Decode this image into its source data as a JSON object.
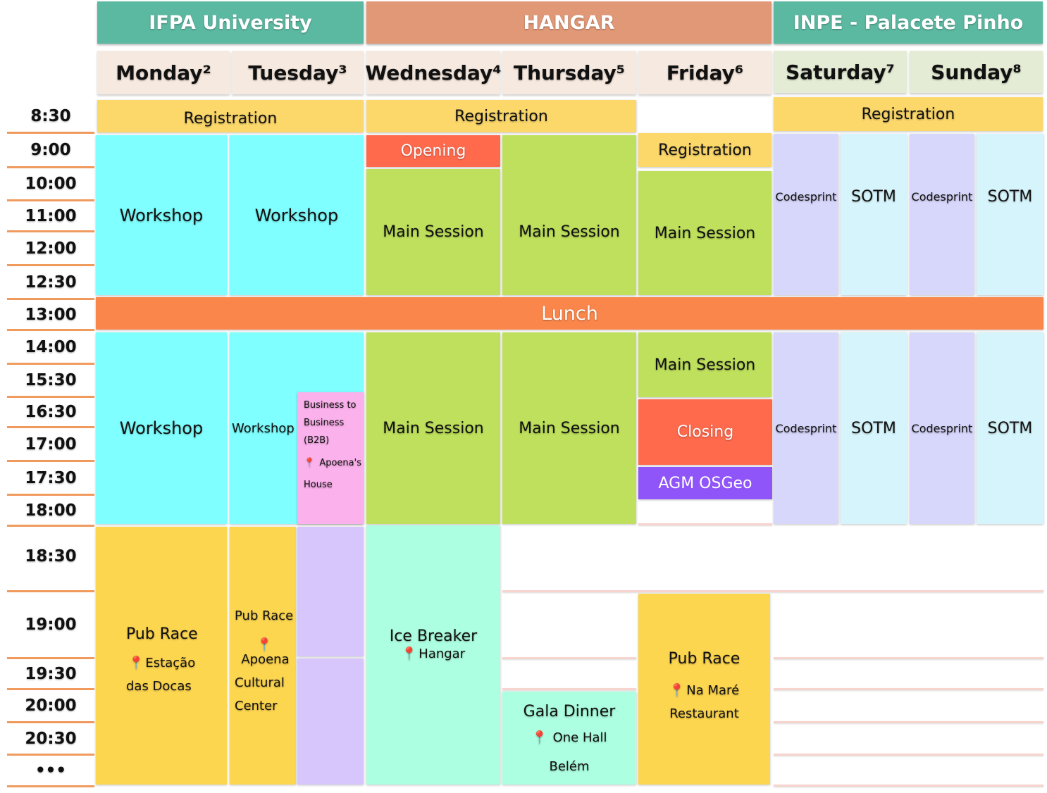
{
  "venues": {
    "ifpa": "IFPA University",
    "hangar": "HANGAR",
    "inpe": "INPE - Palacete Pinho"
  },
  "days": {
    "mon": "Monday²",
    "tue": "Tuesday³",
    "wed": "Wednesday⁴",
    "thu": "Thursday⁵",
    "fri": "Friday⁶",
    "sat": "Saturday⁷",
    "sun": "Sunday⁸"
  },
  "times": [
    "8:30",
    "9:00",
    "10:00",
    "11:00",
    "12:00",
    "12:30",
    "13:00",
    "14:00",
    "15:30",
    "16:30",
    "17:00",
    "17:30",
    "18:00",
    "18:30",
    "19:00",
    "19:30",
    "20:00",
    "20:30",
    "•••"
  ],
  "events": {
    "registration": "Registration",
    "workshop": "Workshop",
    "opening": "Opening",
    "main_session": "Main Session",
    "codesprint": "Codesprint",
    "sotm": "SOTM",
    "lunch": "Lunch",
    "closing": "Closing",
    "agm": "AGM OSGeo",
    "b2b": {
      "line1": "Business to",
      "line2": "Business",
      "line3": "(B2B)",
      "loc": "Apoena's",
      "loc2": "House"
    },
    "pub_race": "Pub Race",
    "mon_evening_loc1": "Estação",
    "mon_evening_loc2": "das Docas",
    "tue_evening_loc1": "Apoena",
    "tue_evening_loc2": "Cultural",
    "tue_evening_loc3": "Center",
    "ice_breaker": "Ice Breaker",
    "ice_breaker_loc": "Hangar",
    "gala": "Gala Dinner",
    "gala_loc1": "One Hall",
    "gala_loc2": "Belém",
    "fri_evening_loc1": "Na Maré",
    "fri_evening_loc2": "Restaurant"
  },
  "icons": {
    "location": "map-pin-icon"
  },
  "colors": {
    "ifpa": "#5cb9a1",
    "hangar": "#e19877",
    "inpe": "#5cb9a1",
    "registration": "#fcd86b",
    "workshop": "#7fffff",
    "main_session": "#bfe05c",
    "opening": "#ff6a4d",
    "lunch": "#fa864b",
    "codesprint": "#d7d6fb",
    "sotm": "#d6f4fb",
    "b2b": "#fbb1ec",
    "pub_race": "#fdd650",
    "ice_breaker": "#adffe1",
    "agm": "#8f55f8",
    "lavender": "#d6c6fb"
  }
}
